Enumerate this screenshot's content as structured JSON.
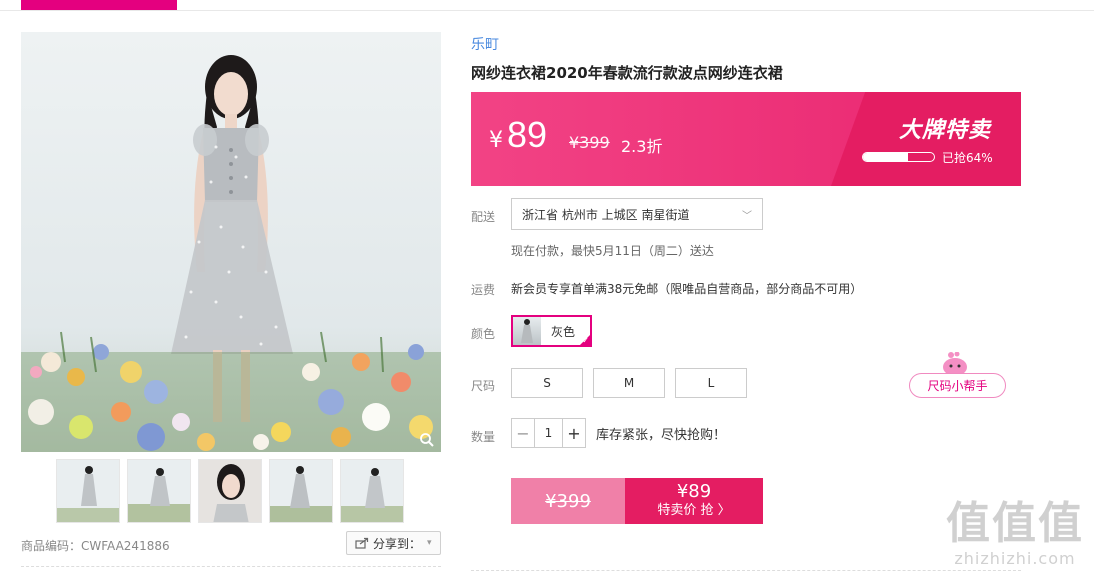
{
  "product": {
    "brand": "乐町",
    "title": "网纱连衣裙2020年春款流行款波点网纱连衣裙",
    "sku_label": "商品编码：CWFAA241886",
    "share_label": "分享到："
  },
  "price": {
    "currency": "¥",
    "current": "89",
    "original": "¥399",
    "discount": "2.3折",
    "event_title": "大牌特卖",
    "sold_text": "已抢64%",
    "sold_fraction": 0.64
  },
  "delivery": {
    "label": "配送",
    "address": "浙江省 杭州市 上城区 南星街道",
    "eta": "现在付款，最快5月11日（周二）送达"
  },
  "shipping": {
    "label": "运费",
    "text": "新会员专享首单满38元免邮（限唯品自营商品，部分商品不可用）"
  },
  "color": {
    "label": "颜色",
    "selected": "灰色"
  },
  "size": {
    "label": "尺码",
    "options": [
      "S",
      "M",
      "L"
    ],
    "helper": "尺码小帮手"
  },
  "quantity": {
    "label": "数量",
    "value": "1",
    "minus": "−",
    "plus": "+",
    "stock_text": "库存紧张，尽快抢购！"
  },
  "buy": {
    "original": "¥399",
    "price": "¥89",
    "action": "特卖价 抢 〉"
  },
  "watermark": {
    "brand": "值值值",
    "url": "zhizhizhi.com"
  },
  "colors": {
    "accent": "#e4007f",
    "band": "#ee2e76",
    "link": "#4a8adf"
  }
}
